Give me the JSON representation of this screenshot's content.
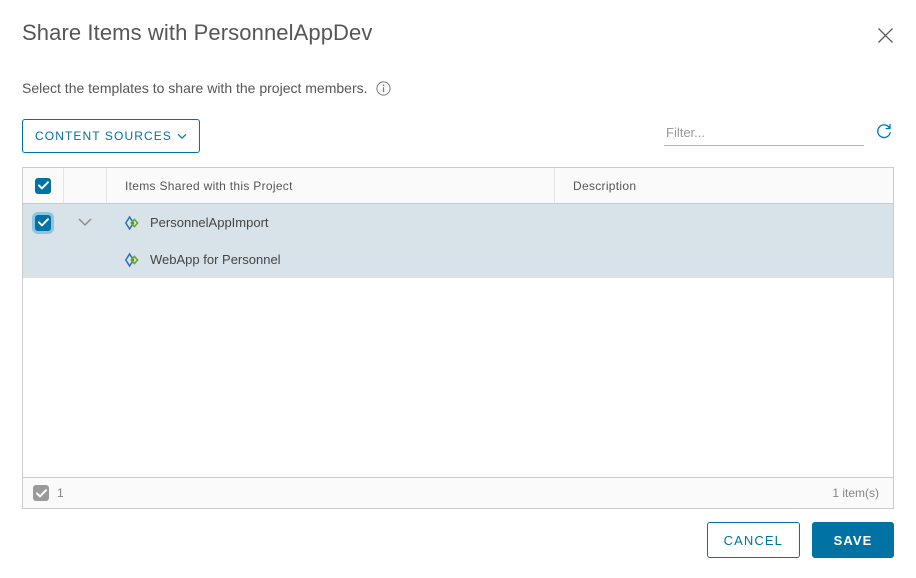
{
  "dialog": {
    "title": "Share Items with PersonnelAppDev",
    "close_icon": "close-icon",
    "subtitle": "Select the templates to share with the project members.",
    "info_icon": "info-icon"
  },
  "toolbar": {
    "content_sources_label": "CONTENT SOURCES",
    "content_sources_caret": "⌄",
    "filter_placeholder": "Filter...",
    "filter_value": "",
    "refresh_icon": "refresh-icon"
  },
  "grid": {
    "columns": [
      {
        "key": "select",
        "label": ""
      },
      {
        "key": "expand",
        "label": ""
      },
      {
        "key": "name",
        "label": "Items Shared with this Project"
      },
      {
        "key": "description",
        "label": "Description"
      }
    ],
    "header_checkbox_checked": true,
    "rows": [
      {
        "name": "PersonnelAppImport",
        "description": "",
        "checked": true,
        "focused": true,
        "expanded": true,
        "has_children": true,
        "level": 0,
        "icon": "template-diamond-icon"
      },
      {
        "name": "WebApp for Personnel",
        "description": "",
        "checked": false,
        "focused": false,
        "expanded": false,
        "has_children": false,
        "level": 1,
        "icon": "template-diamond-icon"
      }
    ],
    "footer": {
      "selected_count": "1",
      "total_label": "1 item(s)"
    }
  },
  "actions": {
    "cancel_label": "CANCEL",
    "save_label": "SAVE"
  },
  "colors": {
    "accent": "#0072a3",
    "row_highlight": "#d7e2e9",
    "text": "#565656",
    "icon_blue": "#1a6fc4",
    "icon_green": "#5aa832"
  }
}
